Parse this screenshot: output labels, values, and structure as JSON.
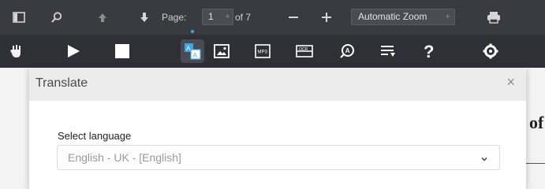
{
  "toolbar": {
    "page_label": "Page:",
    "page_number": "1",
    "page_of": "of 7",
    "zoom_value": "Automatic Zoom",
    "page_spin": "÷",
    "zoom_spin": "÷"
  },
  "tools": [
    {
      "icon": "hand-tool-icon"
    },
    {
      "icon": "play-icon"
    },
    {
      "icon": "stop-icon"
    },
    {
      "icon": "translate-icon"
    },
    {
      "icon": "image-icon"
    },
    {
      "icon": "mp3-icon"
    },
    {
      "icon": "ocr-icon"
    },
    {
      "icon": "search-text-icon"
    },
    {
      "icon": "playlist-add-icon"
    },
    {
      "icon": "help-icon"
    },
    {
      "icon": "settings-icon"
    }
  ],
  "dialog": {
    "title": "Translate",
    "close": "×",
    "select_label": "Select language",
    "selected_language": "English - UK - [English]"
  },
  "background": {
    "text_fragment": "of"
  },
  "colors": {
    "toolbar_bg": "#3a3b40",
    "toolbar2_bg": "#2f3035",
    "accent": "#3ea6e8"
  }
}
